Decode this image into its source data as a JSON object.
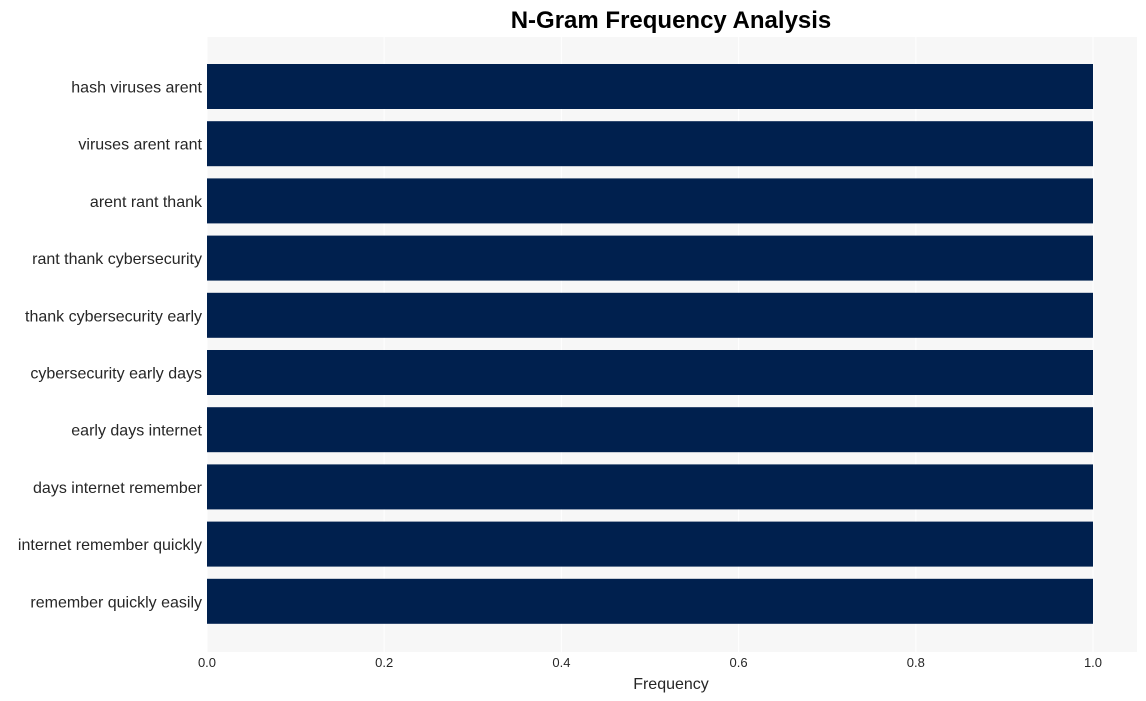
{
  "chart_data": {
    "type": "bar",
    "orientation": "horizontal",
    "title": "N-Gram Frequency Analysis",
    "xlabel": "Frequency",
    "ylabel": "",
    "xlim": [
      0,
      1.05
    ],
    "xticks": [
      "0.0",
      "0.2",
      "0.4",
      "0.6",
      "0.8",
      "1.0"
    ],
    "xtick_values": [
      0,
      0.2,
      0.4,
      0.6,
      0.8,
      1.0
    ],
    "grid": true,
    "legend": null,
    "bar_color": "#00204e",
    "background_color": "#f7f7f7",
    "categories": [
      "hash viruses arent",
      "viruses arent rant",
      "arent rant thank",
      "rant thank cybersecurity",
      "thank cybersecurity early",
      "cybersecurity early days",
      "early days internet",
      "days internet remember",
      "internet remember quickly",
      "remember quickly easily"
    ],
    "values": [
      1,
      1,
      1,
      1,
      1,
      1,
      1,
      1,
      1,
      1
    ]
  }
}
